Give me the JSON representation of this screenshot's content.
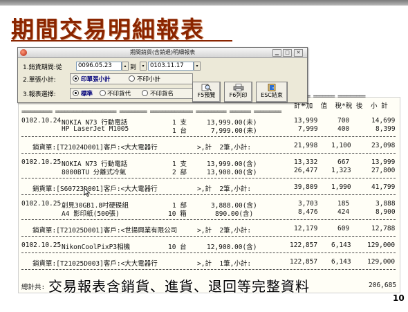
{
  "slide": {
    "title": "期間交易明細報表",
    "caption": "交易報表含銷貨、進貨、退回等完整資料",
    "page_number": "10"
  },
  "dialog": {
    "title": "期間銷貨(含銷退)明細報表",
    "period_label": "1.銷貨期間:從",
    "date_from": "0096.05.23",
    "to_label": "到",
    "date_to": "0103.11.17",
    "subtotal_label": "2.單張小計:",
    "subtotal_options": [
      "印單張小計",
      "不印小計"
    ],
    "format_label": "3.報表選擇:",
    "format_options": [
      "標準",
      "不印貨代",
      "不印貨名"
    ],
    "buttons": [
      "F5預覽",
      "F6列印",
      "ESC結束"
    ]
  },
  "report": {
    "header_partial": "*加  值  稅*稅 後  小 計",
    "header_partial_prefix": "計*",
    "groups": [
      {
        "rows": [
          {
            "date": "0102.10.24",
            "name": "NOKIA N73 行動電話",
            "qty": "1 支",
            "price": "13,999.00(未)",
            "amount": "13,999",
            "tax": "700",
            "total": "14,699"
          },
          {
            "date": "",
            "name": "HP LaserJet M1005",
            "qty": "1 台",
            "price": "7,999.00(未)",
            "amount": "7,999",
            "tax": "400",
            "total": "8,399"
          }
        ],
        "summary": {
          "slip": "銷貨單:[T21024D001]客戶:<大大電器行",
          "count": ">,計  2筆,小計:",
          "amount": "21,998",
          "tax": "1,100",
          "total": "23,098"
        }
      },
      {
        "rows": [
          {
            "date": "0102.10.25",
            "name": "NOKIA N73 行動電話",
            "qty": "1 支",
            "price": "13,999.00(含)",
            "amount": "13,332",
            "tax": "667",
            "total": "13,999"
          },
          {
            "date": "",
            "name": "8000BTU 分離式冷氣",
            "qty": "2 部",
            "price": "13,900.00(含)",
            "amount": "26,477",
            "tax": "1,323",
            "total": "27,800"
          }
        ],
        "summary": {
          "slip": "銷貨單:[S60723D001]客戶:<大大電器行",
          "count": ">,計  2筆,小計:",
          "amount": "39,809",
          "tax": "1,990",
          "total": "41,799"
        }
      },
      {
        "rows": [
          {
            "date": "0102.10.25",
            "name": "創見30GB1.8吋硬碟組",
            "qty": "1 部",
            "price": "3,888.00(含)",
            "amount": "3,703",
            "tax": "185",
            "total": "3,888"
          },
          {
            "date": "",
            "name": "A4 影印紙(500張)",
            "qty": "10 箱",
            "price": "890.00(含)",
            "amount": "8,476",
            "tax": "424",
            "total": "8,900"
          }
        ],
        "summary": {
          "slip": "銷貨單:[T21025D001]客戶:<世揚興業有限公司",
          "count": ">,計  2筆,小計:",
          "amount": "12,179",
          "tax": "609",
          "total": "12,788"
        }
      },
      {
        "rows": [
          {
            "date": "0102.10.25",
            "name": "NikonCoolPixP3相機",
            "qty": "10 台",
            "price": "12,900.00(含)",
            "amount": "122,857",
            "tax": "6,143",
            "total": "129,000"
          }
        ],
        "summary": {
          "slip": "銷貨單:[T21025D003]客戶:<大大電器行",
          "count": ">,計  1筆,小計:",
          "amount": "122,857",
          "tax": "6,143",
          "total": "129,000"
        }
      }
    ],
    "grand_total_label": "總計共:",
    "grand_total": "206,685"
  }
}
